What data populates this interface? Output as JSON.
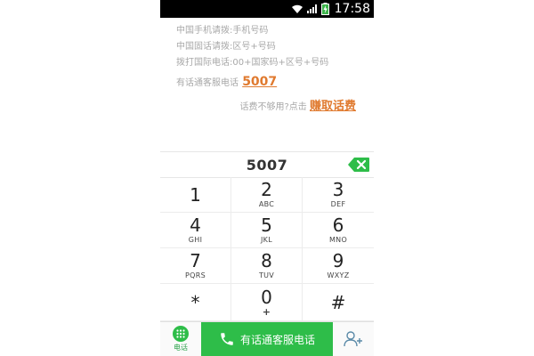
{
  "status_bar": {
    "time": "17:58"
  },
  "info": {
    "lines": [
      "中国手机请拨:手机号码",
      "中国固话请拨:区号+号码",
      "拨打国际电话:00+国家码+区号+号码"
    ],
    "hotline_prefix": "有话通客服电话",
    "hotline_number": "5007",
    "earn_prefix": "话费不够用?点击",
    "earn_link": "赚取话费"
  },
  "dialer": {
    "number": "5007"
  },
  "keypad": [
    {
      "digit": "1",
      "letters": ""
    },
    {
      "digit": "2",
      "letters": "ABC"
    },
    {
      "digit": "3",
      "letters": "DEF"
    },
    {
      "digit": "4",
      "letters": "GHI"
    },
    {
      "digit": "5",
      "letters": "JKL"
    },
    {
      "digit": "6",
      "letters": "MNO"
    },
    {
      "digit": "7",
      "letters": "PQRS"
    },
    {
      "digit": "8",
      "letters": "TUV"
    },
    {
      "digit": "9",
      "letters": "WXYZ"
    },
    {
      "digit": "*",
      "letters": ""
    },
    {
      "digit": "0",
      "letters": "+"
    },
    {
      "digit": "#",
      "letters": ""
    }
  ],
  "bottom_bar": {
    "phone_tab_label": "电话",
    "call_button_label": "有话通客服电话"
  },
  "colors": {
    "accent_green": "#2ebd49",
    "link_orange": "#e07a2f",
    "hint_gray": "#a8a8a8"
  },
  "icons": [
    "wifi-icon",
    "signal-icon",
    "battery-charging-icon",
    "backspace-icon",
    "dialpad-icon",
    "phone-icon",
    "add-contact-icon"
  ]
}
